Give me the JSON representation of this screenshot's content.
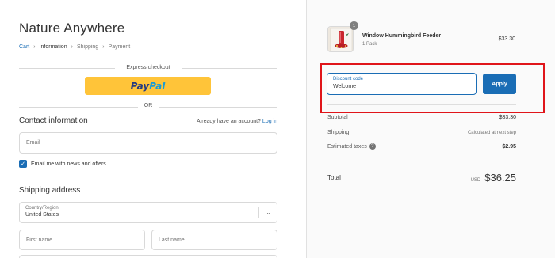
{
  "store": {
    "name": "Nature Anywhere"
  },
  "breadcrumb": {
    "items": [
      "Cart",
      "Information",
      "Shipping",
      "Payment"
    ],
    "separator": "›"
  },
  "express": {
    "label": "Express checkout",
    "paypal_pay": "Pay",
    "paypal_pal": "Pal",
    "or_label": "OR"
  },
  "contact": {
    "title": "Contact information",
    "account_prompt": "Already have an account?",
    "login_label": "Log in",
    "email_placeholder": "Email",
    "newsletter_label": "Email me with news and offers",
    "newsletter_checked": true
  },
  "shipping": {
    "title": "Shipping address",
    "country_label": "Country/Region",
    "country_value": "United States",
    "first_name_placeholder": "First name",
    "last_name_placeholder": "Last name"
  },
  "order": {
    "item": {
      "name": "Window Hummingbird Feeder",
      "variant": "1 Pack",
      "price": "$33.30",
      "quantity": "1"
    },
    "discount": {
      "label": "Discount code",
      "value": "Welcome",
      "apply_label": "Apply"
    },
    "summary": {
      "subtotal_label": "Subtotal",
      "subtotal_value": "$33.30",
      "shipping_label": "Shipping",
      "shipping_value": "Calculated at next step",
      "taxes_label": "Estimated taxes",
      "taxes_value": "$2.95"
    },
    "total": {
      "label": "Total",
      "currency": "USD",
      "amount": "$36.25"
    }
  },
  "colors": {
    "accent": "#1a6db5",
    "paypal_yellow": "#ffc439",
    "highlight_red": "#e0151a"
  }
}
